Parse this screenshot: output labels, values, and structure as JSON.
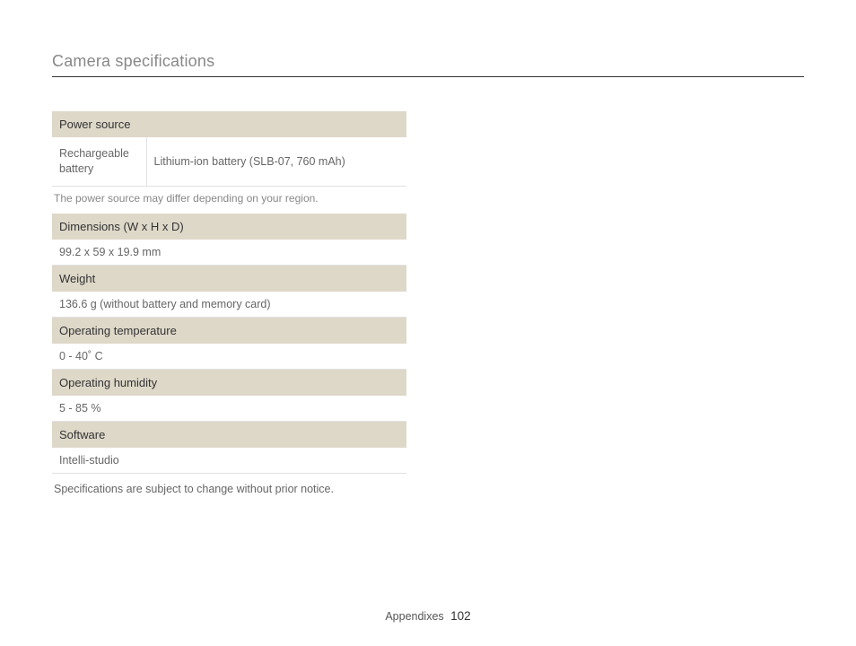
{
  "title": "Camera specifications",
  "sections": [
    {
      "header": "Power source",
      "kv": {
        "label": "Rechargeable battery",
        "value": "Lithium-ion battery (SLB-07, 760 mAh)"
      },
      "note": "The power source may differ depending on your region."
    },
    {
      "header": "Dimensions (W x H x D)",
      "value": "99.2 x 59 x 19.9 mm"
    },
    {
      "header": "Weight",
      "value": "136.6 g (without battery and memory card)"
    },
    {
      "header": "Operating temperature",
      "value": "0 - 40˚ C"
    },
    {
      "header": "Operating humidity",
      "value": "5 - 85 %"
    },
    {
      "header": "Software",
      "value": "Intelli-studio"
    }
  ],
  "footnote": "Specifications are subject to change without prior notice.",
  "footer": {
    "section": "Appendixes",
    "page": "102"
  }
}
